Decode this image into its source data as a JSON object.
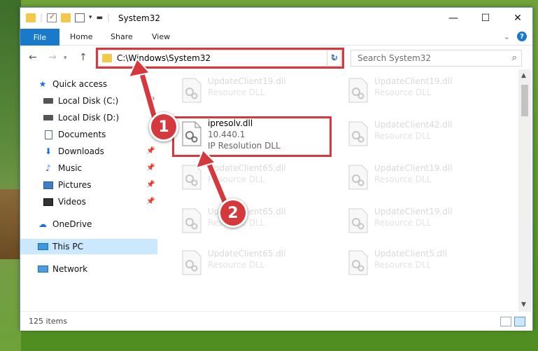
{
  "window": {
    "title": "System32"
  },
  "ribbon": {
    "tabs": [
      "File",
      "Home",
      "Share",
      "View"
    ]
  },
  "address": {
    "path": "C:\\Windows\\System32"
  },
  "search": {
    "placeholder": "Search System32"
  },
  "sidebar": {
    "items": [
      {
        "label": "Quick access",
        "icon": "star-icon",
        "pinned": false
      },
      {
        "label": "Local Disk (C:)",
        "icon": "disk-icon",
        "pinned": true
      },
      {
        "label": "Local Disk (D:)",
        "icon": "disk-icon",
        "pinned": false
      },
      {
        "label": "Documents",
        "icon": "documents-icon",
        "pinned": false
      },
      {
        "label": "Downloads",
        "icon": "downloads-icon",
        "pinned": true
      },
      {
        "label": "Music",
        "icon": "music-icon",
        "pinned": true
      },
      {
        "label": "Pictures",
        "icon": "pictures-icon",
        "pinned": true
      },
      {
        "label": "Videos",
        "icon": "videos-icon",
        "pinned": true
      },
      {
        "label": "OneDrive",
        "icon": "cloud-icon",
        "pinned": false
      },
      {
        "label": "This PC",
        "icon": "pc-icon",
        "pinned": false,
        "selected": true
      },
      {
        "label": "Network",
        "icon": "network-icon",
        "pinned": false
      }
    ]
  },
  "files": [
    {
      "name": "UpdateClient19.dll",
      "desc": "Resource DLL"
    },
    {
      "name": "UpdateClient19.dll",
      "desc": "Resource DLL"
    },
    {
      "name": "ipresolv.dll",
      "version": "10.440.1",
      "desc": "IP Resolution DLL"
    },
    {
      "name": "UpdateClient42.dll",
      "desc": "Resource DLL"
    },
    {
      "name": "UpdateClient65.dll",
      "desc": "Resource DLL"
    },
    {
      "name": "UpdateClient19.dll",
      "desc": "Resource DLL"
    },
    {
      "name": "UpdateClient65.dll",
      "desc": "Resource DLL"
    },
    {
      "name": "UpdateClient19.dll",
      "desc": "Resource DLL"
    },
    {
      "name": "UpdateClient65.dll",
      "desc": "Resource DLL"
    },
    {
      "name": "UpdateClient5.dll",
      "desc": "Resource DLL"
    }
  ],
  "status": {
    "count": "125 items"
  },
  "annotations": {
    "step1": "1",
    "step2": "2"
  },
  "colors": {
    "accent": "#1979ca",
    "highlight": "#d5383d"
  }
}
